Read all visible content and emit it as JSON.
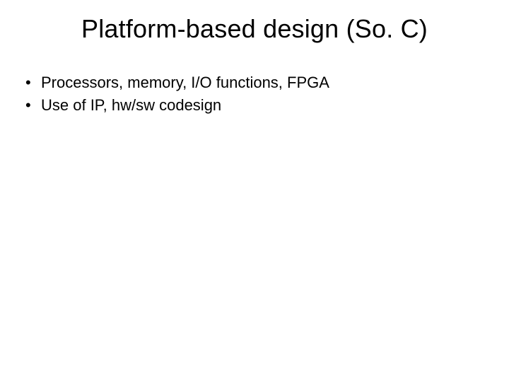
{
  "slide": {
    "title": "Platform-based design (So. C)",
    "bullets": [
      "Processors, memory, I/O functions, FPGA",
      "Use of IP, hw/sw codesign"
    ]
  }
}
